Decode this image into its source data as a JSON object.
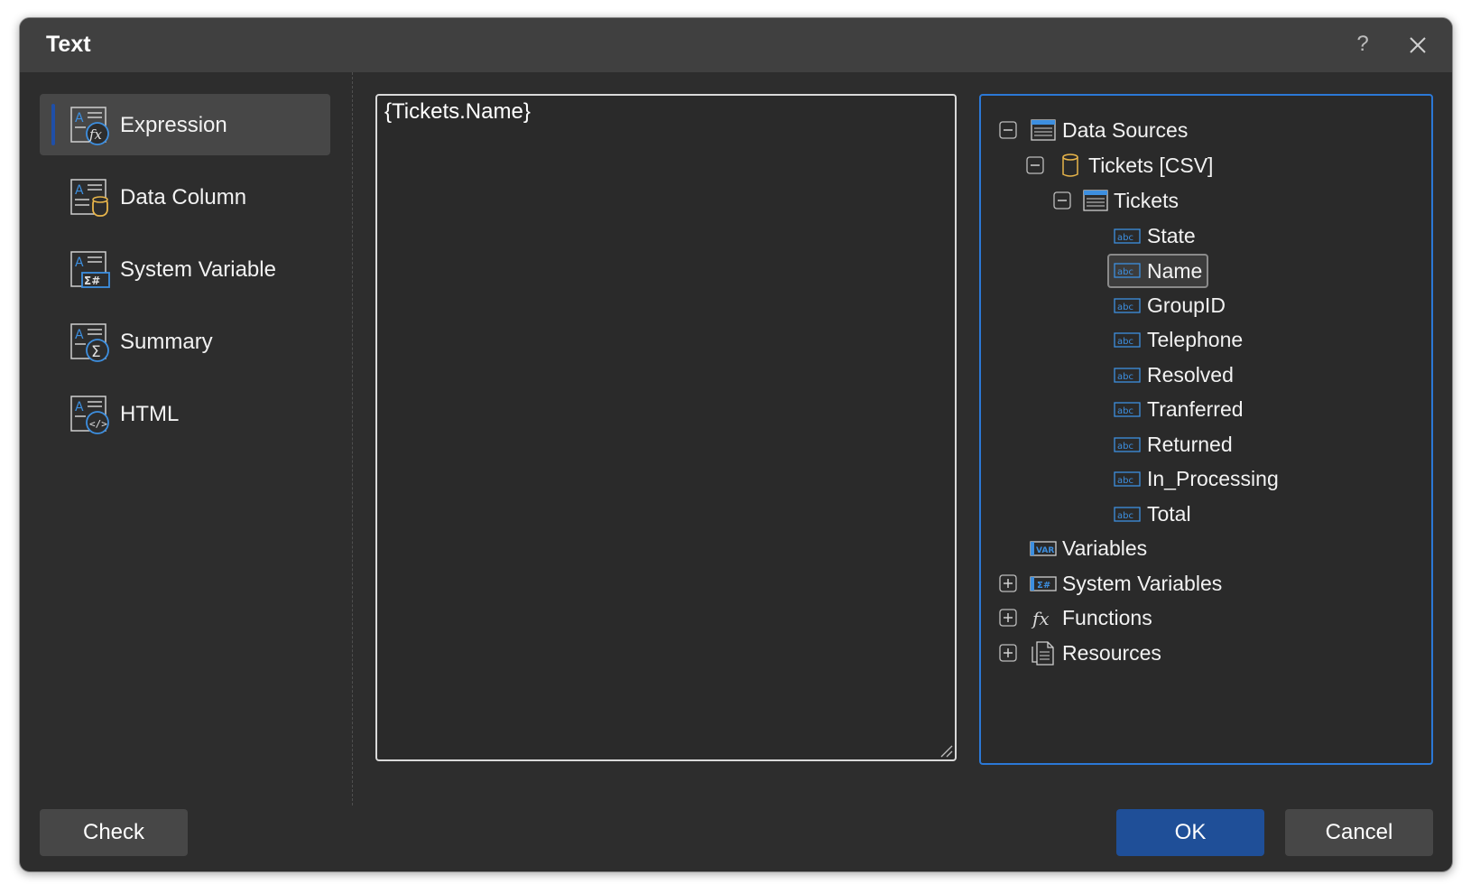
{
  "dialog": {
    "title": "Text",
    "help_label": "?"
  },
  "sidebar": {
    "items": [
      {
        "label": "Expression",
        "icon": "expression-icon",
        "active": true
      },
      {
        "label": "Data Column",
        "icon": "data-column-icon",
        "active": false
      },
      {
        "label": "System Variable",
        "icon": "system-variable-icon",
        "active": false
      },
      {
        "label": "Summary",
        "icon": "summary-icon",
        "active": false
      },
      {
        "label": "HTML",
        "icon": "html-icon",
        "active": false
      }
    ]
  },
  "expression": {
    "value": "{Tickets.Name}"
  },
  "tree": {
    "data_sources": "Data Sources",
    "connection": "Tickets [CSV]",
    "table": "Tickets",
    "columns": [
      "State",
      "Name",
      "GroupID",
      "Telephone",
      "Resolved",
      "Tranferred",
      "Returned",
      "In_Processing",
      "Total"
    ],
    "selected_column": "Name",
    "variables": "Variables",
    "system_variables": "System Variables",
    "functions": "Functions",
    "resources": "Resources",
    "column_icon_text": "abc",
    "variables_icon_text": "VAR"
  },
  "buttons": {
    "check": "Check",
    "ok": "OK",
    "cancel": "Cancel"
  },
  "colors": {
    "accent": "#2b78d6",
    "ok_button": "#1f4f98",
    "dialog_bg": "#2d2d2d",
    "titlebar_bg": "#404040"
  }
}
